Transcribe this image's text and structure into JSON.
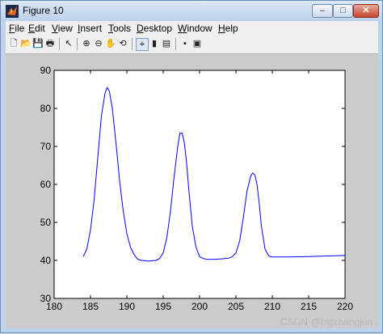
{
  "window": {
    "title": "Figure 10",
    "controls": {
      "minimize": "–",
      "maximize": "□",
      "close": "✕"
    }
  },
  "menubar": [
    {
      "label": "File",
      "mnemonic": "F",
      "rest": "ile"
    },
    {
      "label": "Edit",
      "mnemonic": "E",
      "rest": "dit"
    },
    {
      "label": "View",
      "mnemonic": "V",
      "rest": "iew"
    },
    {
      "label": "Insert",
      "mnemonic": "I",
      "rest": "nsert"
    },
    {
      "label": "Tools",
      "mnemonic": "T",
      "rest": "ools"
    },
    {
      "label": "Desktop",
      "mnemonic": "D",
      "rest": "esktop"
    },
    {
      "label": "Window",
      "mnemonic": "W",
      "rest": "indow"
    },
    {
      "label": "Help",
      "mnemonic": "H",
      "rest": "elp"
    }
  ],
  "toolbar": {
    "icons": [
      "new-figure-icon",
      "open-file-icon",
      "save-icon",
      "print-icon",
      "edit-plot-icon",
      "zoom-in-icon",
      "zoom-out-icon",
      "pan-icon",
      "rotate-3d-icon",
      "data-cursor-icon",
      "colorbar-icon",
      "legend-icon",
      "hide-plot-tools-icon",
      "show-plot-tools-icon"
    ]
  },
  "watermark": "CSDN @bigzhangjun",
  "chart_data": {
    "type": "line",
    "title": "",
    "xlabel": "",
    "ylabel": "",
    "xlim": [
      180,
      220
    ],
    "ylim": [
      30,
      90
    ],
    "xticks": [
      180,
      185,
      190,
      195,
      200,
      205,
      210,
      215,
      220
    ],
    "yticks": [
      30,
      40,
      50,
      60,
      70,
      80,
      90
    ],
    "grid": false,
    "line_color": "#0000ff",
    "series": [
      {
        "x": [
          184,
          184.5,
          185,
          185.5,
          186,
          186.5,
          187,
          187.3,
          187.6,
          188,
          188.5,
          189,
          189.5,
          190,
          190.5,
          191,
          191.5,
          192,
          193,
          194,
          194.5,
          195,
          195.5,
          196,
          196.5,
          197,
          197.3,
          197.6,
          197.9,
          198.2,
          198.5,
          199,
          199.5,
          200,
          200.5,
          201,
          202,
          203,
          204,
          204.5,
          205,
          205.5,
          206,
          206.5,
          207,
          207.3,
          207.6,
          207.9,
          208.2,
          208.5,
          209,
          209.5,
          210,
          212,
          215,
          218,
          220
        ],
        "values": [
          41,
          43,
          48,
          56,
          67,
          78,
          84,
          85.5,
          84.5,
          80,
          71,
          61,
          53,
          47,
          43.5,
          41.5,
          40.3,
          40,
          39.8,
          40,
          40.5,
          42,
          46,
          53,
          62,
          70,
          73.5,
          73.5,
          71,
          66,
          59,
          49,
          43.5,
          41,
          40.5,
          40.3,
          40.3,
          40.4,
          40.6,
          41,
          42,
          45,
          51,
          58,
          62,
          63,
          62.5,
          60,
          55,
          49,
          43,
          41.2,
          40.9,
          40.9,
          41,
          41.2,
          41.3
        ]
      }
    ]
  }
}
